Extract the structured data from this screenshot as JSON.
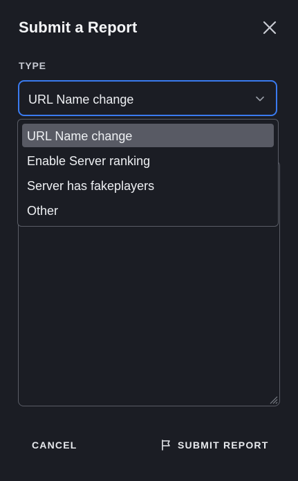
{
  "dialog": {
    "title": "Submit a Report",
    "close_icon": "close-icon"
  },
  "form": {
    "type_label": "TYPE",
    "type_selected": "URL Name change",
    "chevron_icon": "chevron-down-icon"
  },
  "dropdown": {
    "options": [
      {
        "label": "URL Name change",
        "selected": true
      },
      {
        "label": "Enable Server ranking",
        "selected": false
      },
      {
        "label": "Server has fakeplayers",
        "selected": false
      },
      {
        "label": "Other",
        "selected": false
      }
    ]
  },
  "footer": {
    "cancel_label": "CANCEL",
    "submit_label": "SUBMIT REPORT",
    "submit_icon": "flag-icon"
  },
  "colors": {
    "background": "#1b1d24",
    "accent_border": "#3a7bf0",
    "option_highlight": "#585a64"
  }
}
